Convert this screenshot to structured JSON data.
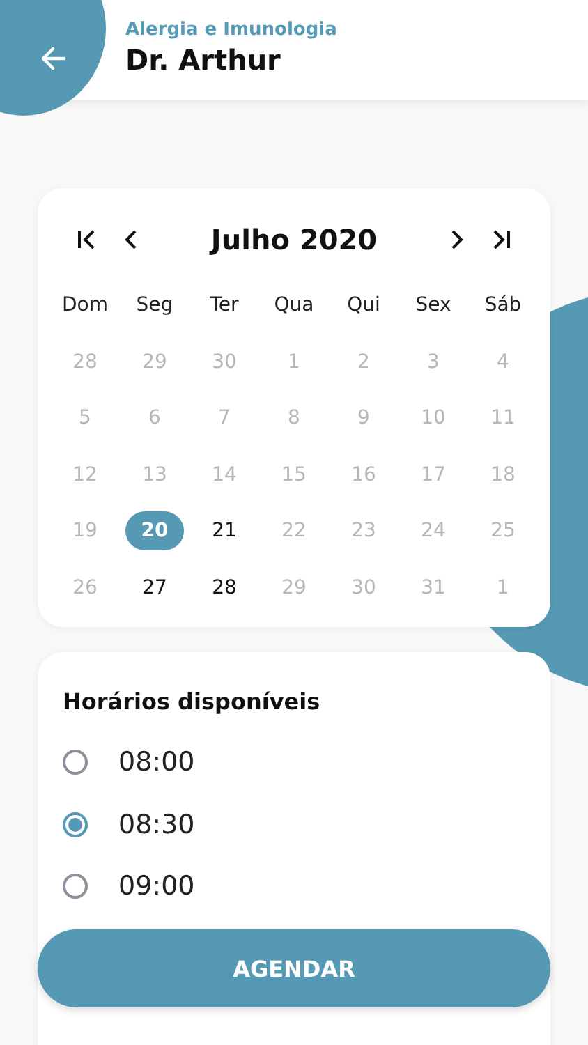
{
  "header": {
    "subtitle": "Alergia e Imunologia",
    "title": "Dr. Arthur"
  },
  "calendar": {
    "month": "Julho 2020",
    "weekdays": [
      "Dom",
      "Seg",
      "Ter",
      "Qua",
      "Qui",
      "Sex",
      "Sáb"
    ],
    "days": [
      {
        "label": "28",
        "disabled": true,
        "selected": false
      },
      {
        "label": "29",
        "disabled": true,
        "selected": false
      },
      {
        "label": "30",
        "disabled": true,
        "selected": false
      },
      {
        "label": "1",
        "disabled": true,
        "selected": false
      },
      {
        "label": "2",
        "disabled": true,
        "selected": false
      },
      {
        "label": "3",
        "disabled": true,
        "selected": false
      },
      {
        "label": "4",
        "disabled": true,
        "selected": false
      },
      {
        "label": "5",
        "disabled": true,
        "selected": false
      },
      {
        "label": "6",
        "disabled": true,
        "selected": false
      },
      {
        "label": "7",
        "disabled": true,
        "selected": false
      },
      {
        "label": "8",
        "disabled": true,
        "selected": false
      },
      {
        "label": "9",
        "disabled": true,
        "selected": false
      },
      {
        "label": "10",
        "disabled": true,
        "selected": false
      },
      {
        "label": "11",
        "disabled": true,
        "selected": false
      },
      {
        "label": "12",
        "disabled": true,
        "selected": false
      },
      {
        "label": "13",
        "disabled": true,
        "selected": false
      },
      {
        "label": "14",
        "disabled": true,
        "selected": false
      },
      {
        "label": "15",
        "disabled": true,
        "selected": false
      },
      {
        "label": "16",
        "disabled": true,
        "selected": false
      },
      {
        "label": "17",
        "disabled": true,
        "selected": false
      },
      {
        "label": "18",
        "disabled": true,
        "selected": false
      },
      {
        "label": "19",
        "disabled": true,
        "selected": false
      },
      {
        "label": "20",
        "disabled": false,
        "selected": true
      },
      {
        "label": "21",
        "disabled": false,
        "selected": false
      },
      {
        "label": "22",
        "disabled": true,
        "selected": false
      },
      {
        "label": "23",
        "disabled": true,
        "selected": false
      },
      {
        "label": "24",
        "disabled": true,
        "selected": false
      },
      {
        "label": "25",
        "disabled": true,
        "selected": false
      },
      {
        "label": "26",
        "disabled": true,
        "selected": false
      },
      {
        "label": "27",
        "disabled": false,
        "selected": false
      },
      {
        "label": "28",
        "disabled": false,
        "selected": false
      },
      {
        "label": "29",
        "disabled": true,
        "selected": false
      },
      {
        "label": "30",
        "disabled": true,
        "selected": false
      },
      {
        "label": "31",
        "disabled": true,
        "selected": false
      },
      {
        "label": "1",
        "disabled": true,
        "selected": false
      }
    ]
  },
  "schedule": {
    "title": "Horários disponíveis",
    "times": [
      {
        "label": "08:00",
        "selected": false
      },
      {
        "label": "08:30",
        "selected": true
      },
      {
        "label": "09:00",
        "selected": false
      }
    ]
  },
  "action": {
    "label": "AGENDAR"
  }
}
